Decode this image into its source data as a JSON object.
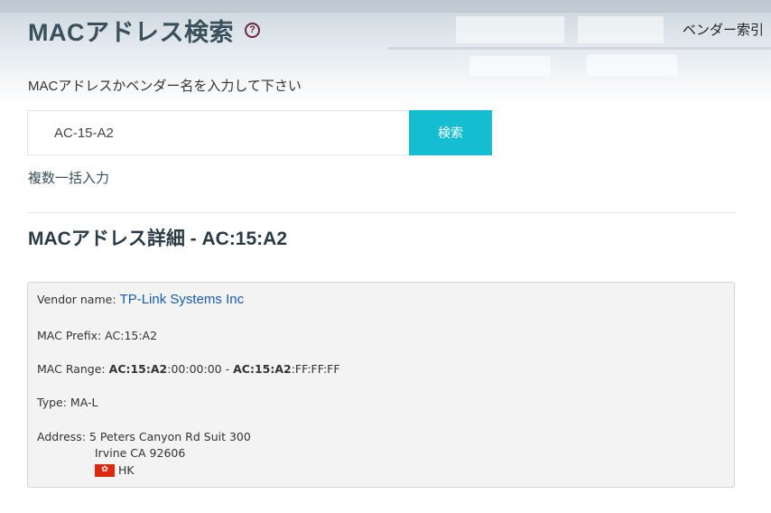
{
  "header": {
    "title": "MACアドレス検索",
    "help_icon": "question-circle-icon",
    "vendor_index_label": "ベンダー索引"
  },
  "search": {
    "prompt": "MACアドレスかベンダー名を入力して下さい",
    "input_value": "AC-15-A2",
    "button_label": "検索",
    "bulk_link_label": "複数一括入力"
  },
  "details": {
    "title": "MACアドレス詳細 - AC:15:A2",
    "vendor_name_label": "Vendor name:",
    "vendor_name": "TP-Link Systems Inc",
    "mac_prefix_label": "MAC Prefix:",
    "mac_prefix": "AC:15:A2",
    "mac_range_label": "MAC Range:",
    "mac_range_start_prefix": "AC:15:A2",
    "mac_range_start_suffix": ":00:00:00",
    "mac_range_separator": " - ",
    "mac_range_end_prefix": "AC:15:A2",
    "mac_range_end_suffix": ":FF:FF:FF",
    "type_label": "Type:",
    "type": "MA-L",
    "address_label": "Address:",
    "address_line1": "5 Peters Canyon Rd Suit 300",
    "address_line2": "Irvine CA 92606",
    "country_flag_icon": "flag-hk-icon",
    "country": "HK"
  },
  "colors": {
    "accent": "#14bdd0",
    "title": "#3a505c",
    "link": "#1a5ca8",
    "help_icon": "#6b2c3c"
  }
}
